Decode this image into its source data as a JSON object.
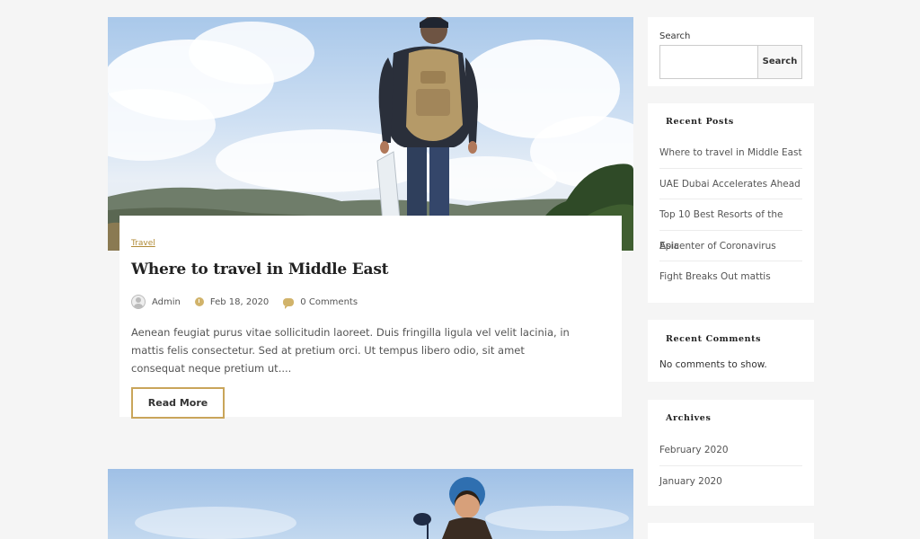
{
  "post": {
    "category": "Travel",
    "title": "Where to travel in Middle East",
    "author": "Admin",
    "date": "Feb 18, 2020",
    "comments": "0 Comments",
    "excerpt": "Aenean feugiat purus vitae sollicitudin laoreet. Duis fringilla ligula vel velit lacinia, in mattis felis consectetur. Sed at pretium orci. Ut tempus libero odio, sit amet consequat neque pretium ut....",
    "read_more": "Read More"
  },
  "sidebar": {
    "search": {
      "label": "Search",
      "button": "Search",
      "value": ""
    },
    "recent_posts": {
      "title": "Recent Posts",
      "items": [
        "Where to travel in Middle East",
        "UAE Dubai Accelerates Ahead",
        "Top 10 Best Resorts of the Asia",
        "Epicenter of Coronavirus",
        "Fight Breaks Out mattis"
      ]
    },
    "recent_comments": {
      "title": "Recent Comments",
      "empty": "No comments to show."
    },
    "archives": {
      "title": "Archives",
      "items": [
        "February 2020",
        "January 2020"
      ]
    }
  },
  "colors": {
    "accent": "#c9a55a",
    "background": "#f5f5f5"
  }
}
